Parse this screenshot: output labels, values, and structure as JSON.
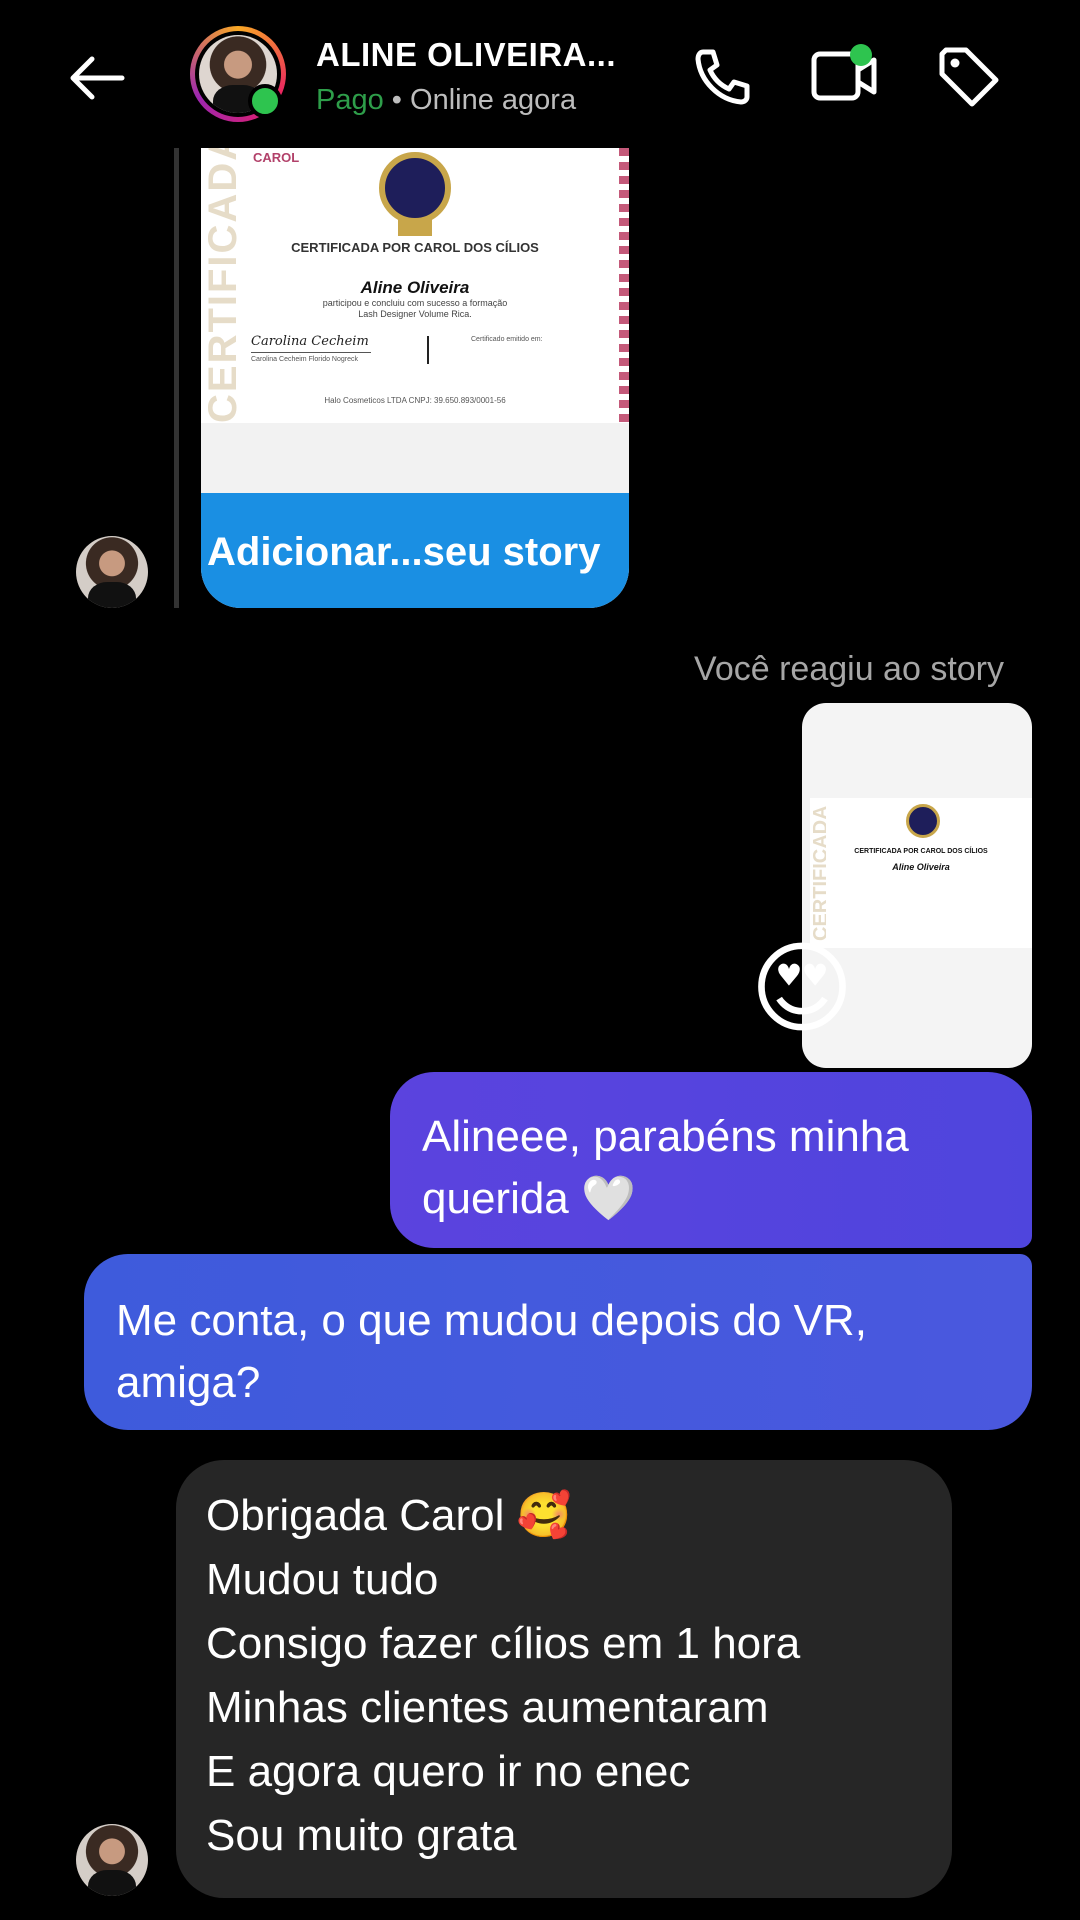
{
  "header": {
    "name": "ALINE OLIVEIRA...",
    "status_paid": "Pago",
    "status_separator": " • ",
    "status_online": "Online agora"
  },
  "story_reply": {
    "certificate": {
      "side_text": "CERTIFICADA",
      "brand": "CAROL",
      "title": "CERTIFICADA POR CAROL DOS CÍLIOS",
      "name": "Aline Oliveira",
      "line1": "participou e concluiu com sucesso a formação",
      "line2": "Lash Designer Volume Rica.",
      "signature": "Carolina Cecheim",
      "signature_name": "Carolina Cecheim Florido Nogreck",
      "emitted": "Certificado emitido em:",
      "footer": "Halo Cosmeticos LTDA CNPJ: 39.650.893/0001-56"
    },
    "cta_label": "Adicionar...seu story"
  },
  "reaction": {
    "label": "Você reagiu ao story",
    "emoji": "😍",
    "thumb_title": "CERTIFICADA POR CAROL DOS CÍLIOS",
    "thumb_name": "Aline Oliveira",
    "thumb_side": "CERTIFICADA"
  },
  "messages": {
    "sent_1": [
      "Alineee, parabéns minha",
      "querida 🤍"
    ],
    "sent_2": [
      "Me conta, o que mudou depois do VR,",
      "amiga?"
    ],
    "received": [
      "Obrigada Carol  🥰",
      "Mudou tudo",
      "Consigo fazer cílios em 1 hora",
      "Minhas clientes aumentaram",
      "E agora quero ir no enec",
      "Sou muito grata"
    ]
  },
  "colors": {
    "background": "#000000",
    "online": "#2ec44f",
    "paid": "#2e9e4a",
    "cta": "#1a8fe3",
    "sent_bubble": "#5b43de",
    "received_bubble": "#262626"
  },
  "icons": [
    "back-arrow-icon",
    "phone-icon",
    "video-camera-icon",
    "tag-icon"
  ]
}
